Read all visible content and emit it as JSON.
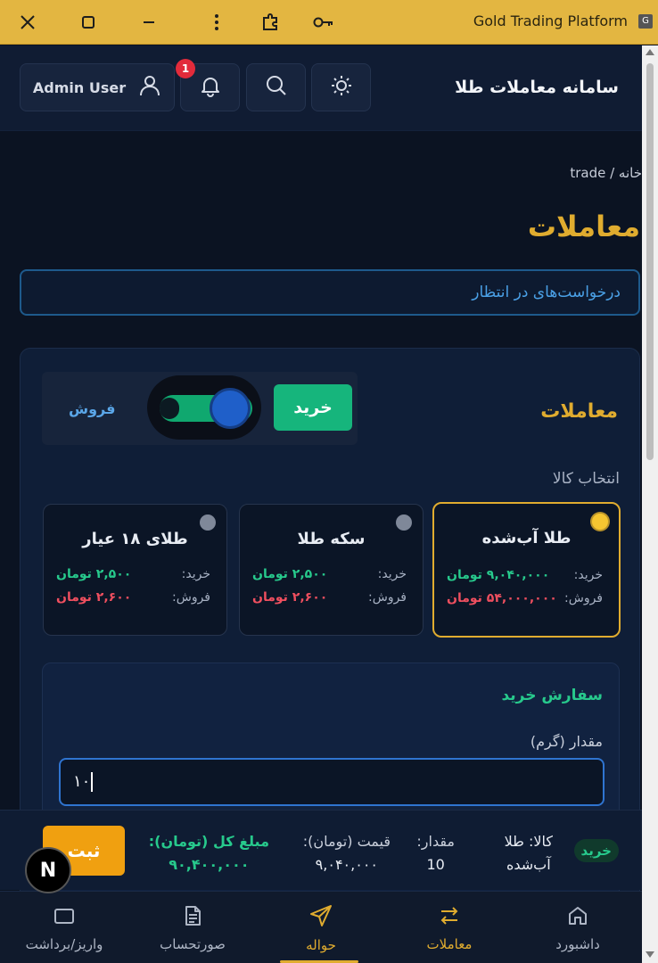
{
  "window": {
    "title": "Gold Trading Platform",
    "tab_letter": "G"
  },
  "header": {
    "app_title": "سامانه معاملات طلا",
    "user_name": "Admin User",
    "notification_count": "1"
  },
  "breadcrumb": {
    "text": "خانه / trade"
  },
  "page_title": "معاملات",
  "pending_requests": "درخواست‌های در انتظار",
  "trade_card": {
    "title": "معاملات",
    "buy_label": "خرید",
    "sell_label": "فروش",
    "select_label": "انتخاب کالا",
    "products": [
      {
        "name": "طلا آب‌شده",
        "buy_key": "خرید:",
        "buy_value": "۹,۰۴۰,۰۰۰ تومان",
        "sell_key": "فروش:",
        "sell_value": "۵۴,۰۰۰,۰۰۰ تومان",
        "selected": true
      },
      {
        "name": "سکه طلا",
        "buy_key": "خرید:",
        "buy_value": "۲,۵۰۰ تومان",
        "sell_key": "فروش:",
        "sell_value": "۲,۶۰۰ تومان",
        "selected": false
      },
      {
        "name": "طلای ۱۸ عیار",
        "buy_key": "خرید:",
        "buy_value": "۲,۵۰۰ تومان",
        "sell_key": "فروش:",
        "sell_value": "۲,۶۰۰ تومان",
        "selected": false
      }
    ],
    "order": {
      "title": "سفارش خرید",
      "qty_label": "مقدار (گرم)",
      "qty_value": "۱۰"
    }
  },
  "summary": {
    "type_badge": "خرید",
    "item_label": "کالا: طلا",
    "item_value": "آب‌شده",
    "qty_label": "مقدار:",
    "qty_value": "10",
    "price_label": "قیمت (تومان):",
    "price_value": "۹,۰۴۰,۰۰۰",
    "total_label": "مبلغ کل (تومان):",
    "total_value": "۹۰,۴۰۰,۰۰۰",
    "submit_label": "ثبت"
  },
  "bottom_nav": [
    {
      "label": "داشبورد",
      "icon": "home-icon"
    },
    {
      "label": "معاملات",
      "icon": "swap-icon",
      "active": true
    },
    {
      "label": "حواله",
      "icon": "send-icon"
    },
    {
      "label": "صورتحساب",
      "icon": "document-icon"
    },
    {
      "label": "واریز/برداشت",
      "icon": "wallet-icon"
    }
  ],
  "colors": {
    "accent": "#e0ac2f",
    "buy": "#16b57c",
    "sell_text": "#ef4f5f",
    "bg": "#0b1322"
  }
}
